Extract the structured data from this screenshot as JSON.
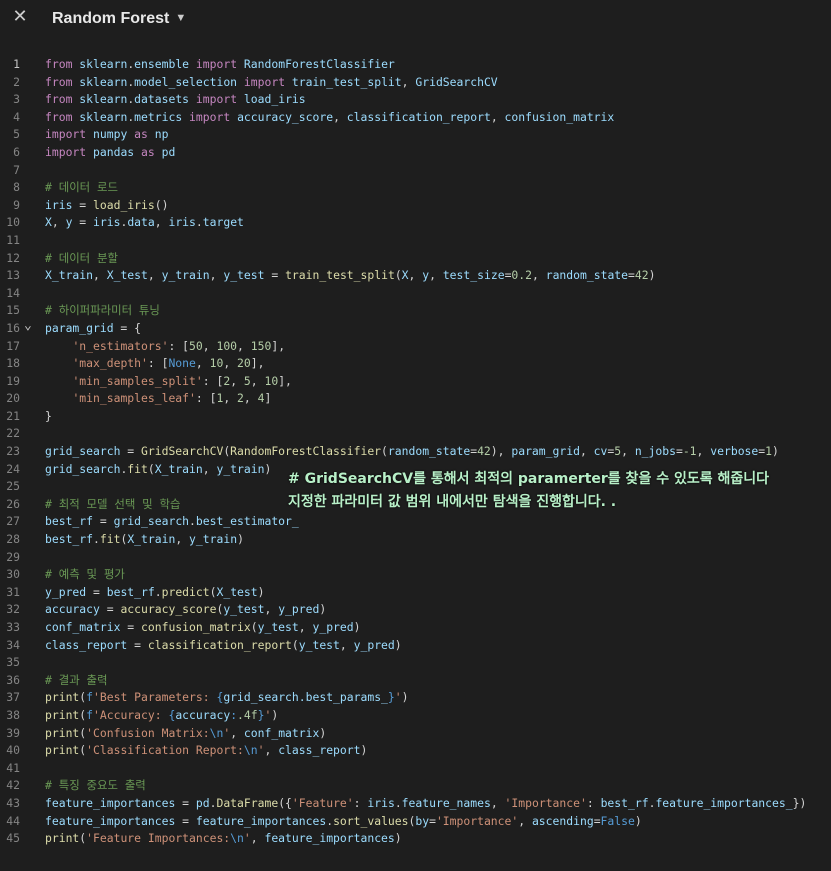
{
  "window": {
    "title": "Random Forest",
    "close_icon": "close-icon",
    "chevron_icon": "chevron-down-icon"
  },
  "overlay": {
    "line1": "# GridSearchCV를 통해서 최적의 paramerter를 찾을 수 있도록 해줍니다",
    "line2": "지정한 파라미터 값 범위 내에서만 탐색을 진행합니다. ."
  },
  "code_lines": [
    "from sklearn.ensemble import RandomForestClassifier",
    "from sklearn.model_selection import train_test_split, GridSearchCV",
    "from sklearn.datasets import load_iris",
    "from sklearn.metrics import accuracy_score, classification_report, confusion_matrix",
    "import numpy as np",
    "import pandas as pd",
    "",
    "# 데이터 로드",
    "iris = load_iris()",
    "X, y = iris.data, iris.target",
    "",
    "# 데이터 분할",
    "X_train, X_test, y_train, y_test = train_test_split(X, y, test_size=0.2, random_state=42)",
    "",
    "# 하이퍼파라미터 튜닝",
    "param_grid = {",
    "    'n_estimators': [50, 100, 150],",
    "    'max_depth': [None, 10, 20],",
    "    'min_samples_split': [2, 5, 10],",
    "    'min_samples_leaf': [1, 2, 4]",
    "}",
    "",
    "grid_search = GridSearchCV(RandomForestClassifier(random_state=42), param_grid, cv=5, n_jobs=-1, verbose=1)",
    "grid_search.fit(X_train, y_train)",
    "",
    "# 최적 모델 선택 및 학습",
    "best_rf = grid_search.best_estimator_",
    "best_rf.fit(X_train, y_train)",
    "",
    "# 예측 및 평가",
    "y_pred = best_rf.predict(X_test)",
    "accuracy = accuracy_score(y_test, y_pred)",
    "conf_matrix = confusion_matrix(y_test, y_pred)",
    "class_report = classification_report(y_test, y_pred)",
    "",
    "# 결과 출력",
    "print(f'Best Parameters: {grid_search.best_params_}')",
    "print(f'Accuracy: {accuracy:.4f}')",
    "print('Confusion Matrix:\\n', conf_matrix)",
    "print('Classification Report:\\n', class_report)",
    "",
    "# 특징 중요도 출력",
    "feature_importances = pd.DataFrame({'Feature': iris.feature_names, 'Importance': best_rf.feature_importances_})",
    "feature_importances = feature_importances.sort_values(by='Importance', ascending=False)",
    "print('Feature Importances:\\n', feature_importances)"
  ],
  "active_line": 1,
  "fold_line": 16,
  "colors": {
    "background": "#1e1e1e",
    "keyword": "#569cd6",
    "import_keyword": "#c586c0",
    "string": "#ce9178",
    "number": "#b5cea8",
    "comment": "#6a9955",
    "function": "#dcdcaa",
    "overlay_text": "#b8f0c8"
  }
}
